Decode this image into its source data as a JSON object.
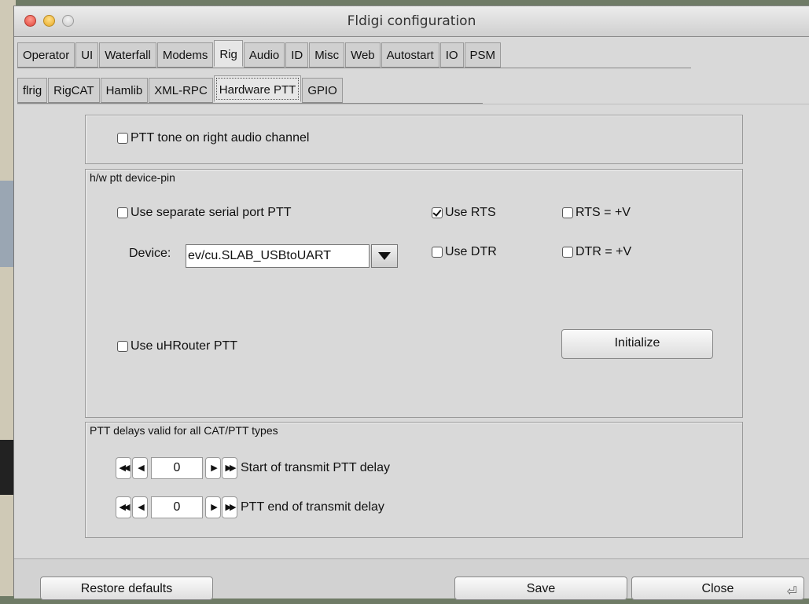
{
  "window": {
    "title": "Fldigi configuration"
  },
  "tabs": [
    {
      "label": "Operator"
    },
    {
      "label": "UI"
    },
    {
      "label": "Waterfall"
    },
    {
      "label": "Modems"
    },
    {
      "label": "Rig",
      "active": true
    },
    {
      "label": "Audio"
    },
    {
      "label": "ID"
    },
    {
      "label": "Misc"
    },
    {
      "label": "Web"
    },
    {
      "label": "Autostart"
    },
    {
      "label": "IO"
    },
    {
      "label": "PSM"
    }
  ],
  "subtabs": [
    {
      "label": "flrig"
    },
    {
      "label": "RigCAT"
    },
    {
      "label": "Hamlib"
    },
    {
      "label": "XML-RPC"
    },
    {
      "label": "Hardware PTT",
      "active": true
    },
    {
      "label": "GPIO"
    }
  ],
  "ptt_tone": {
    "label": "PTT tone on right audio channel",
    "checked": false
  },
  "hw_group": {
    "title": "h/w ptt device-pin",
    "separate_serial": {
      "label": "Use separate serial port PTT",
      "checked": false
    },
    "use_rts": {
      "label": "Use RTS",
      "checked": true
    },
    "rts_v": {
      "label": "RTS = +V",
      "checked": false
    },
    "use_dtr": {
      "label": "Use DTR",
      "checked": false
    },
    "dtr_v": {
      "label": "DTR = +V",
      "checked": false
    },
    "device_label": "Device:",
    "device_value": "ev/cu.SLAB_USBtoUART",
    "uhrouter": {
      "label": "Use uHRouter PTT",
      "checked": false
    },
    "initialize": "Initialize"
  },
  "delays": {
    "title": "PTT delays valid for all CAT/PTT types",
    "start": {
      "value": "0",
      "label": "Start of transmit PTT delay"
    },
    "end": {
      "value": "0",
      "label": "PTT end of transmit delay"
    }
  },
  "buttons": {
    "restore": "Restore defaults",
    "save": "Save",
    "close": "Close"
  },
  "icons": [
    "close-window-icon",
    "minimize-window-icon",
    "zoom-window-icon",
    "dropdown-arrow-icon",
    "fast-rewind-icon",
    "step-back-icon",
    "step-forward-icon",
    "fast-forward-icon",
    "return-key-icon"
  ]
}
